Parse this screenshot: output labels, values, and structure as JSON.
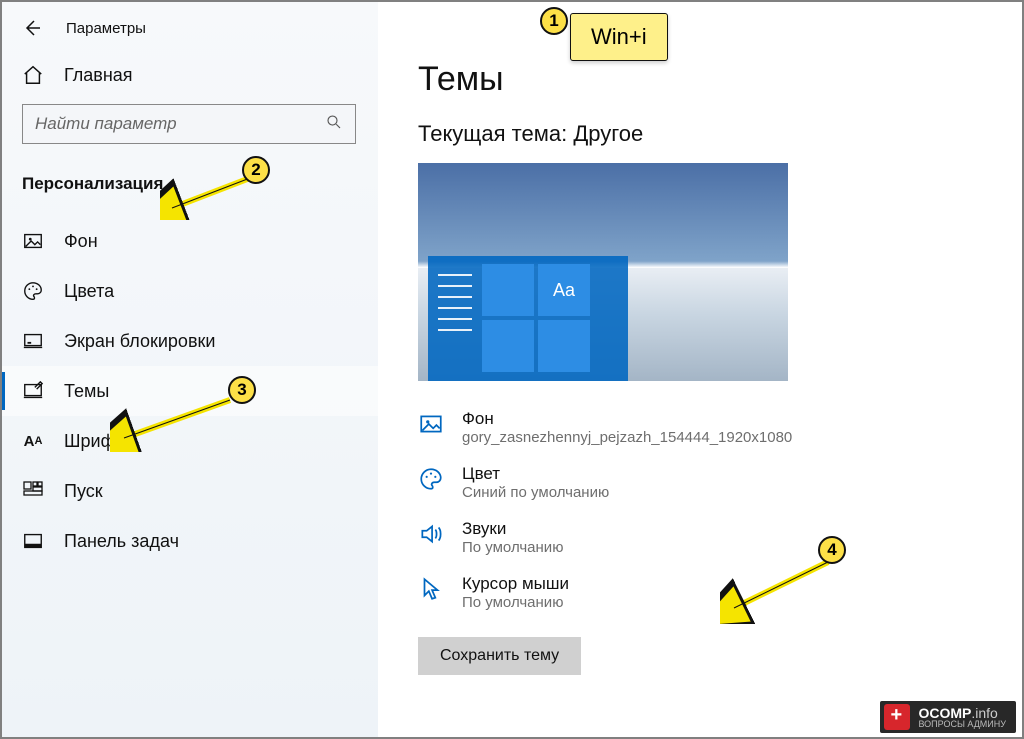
{
  "window": {
    "title": "Параметры"
  },
  "sidebar": {
    "home": "Главная",
    "search_placeholder": "Найти параметр",
    "category": "Персонализация",
    "items": [
      {
        "label": "Фон"
      },
      {
        "label": "Цвета"
      },
      {
        "label": "Экран блокировки"
      },
      {
        "label": "Темы"
      },
      {
        "label": "Шрифты"
      },
      {
        "label": "Пуск"
      },
      {
        "label": "Панель задач"
      }
    ]
  },
  "main": {
    "title": "Темы",
    "subtitle": "Текущая тема: Другое",
    "preview_tile": "Aa",
    "opts": {
      "background": {
        "label": "Фон",
        "value": "gory_zasnezhennyj_pejzazh_154444_1920x1080"
      },
      "color": {
        "label": "Цвет",
        "value": "Синий по умолчанию"
      },
      "sounds": {
        "label": "Звуки",
        "value": "По умолчанию"
      },
      "cursor": {
        "label": "Курсор мыши",
        "value": "По умолчанию"
      }
    },
    "save": "Сохранить тему"
  },
  "annotations": {
    "n1": "1",
    "n2": "2",
    "n3": "3",
    "n4": "4",
    "callout": "Win+i"
  },
  "watermark": {
    "brand": "OCOMP",
    "tld": ".info",
    "tagline": "ВОПРОСЫ АДМИНУ"
  }
}
